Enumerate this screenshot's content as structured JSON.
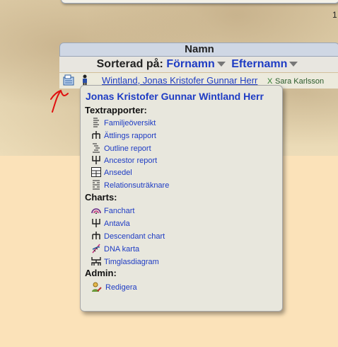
{
  "page": {
    "number": "1"
  },
  "table": {
    "header": "Namn",
    "sort_label": "Sorterad på:",
    "sort_first": "Förnamn",
    "sort_last": "Efternamn"
  },
  "row": {
    "person": "Wintland, Jonas Kristofer Gunnar Herr",
    "x": "X",
    "spouse": "Sara Karlsson"
  },
  "popup": {
    "title": "Jonas Kristofer Gunnar Wintland Herr",
    "sections": {
      "reports": "Textrapporter:",
      "charts": "Charts:",
      "admin": "Admin:"
    },
    "reports": [
      {
        "label": "Familjeöversikt",
        "icon": "family-overview-icon"
      },
      {
        "label": "Ättlings rapport",
        "icon": "descendant-report-icon"
      },
      {
        "label": "Outline report",
        "icon": "outline-report-icon"
      },
      {
        "label": "Ancestor report",
        "icon": "ancestor-report-icon"
      },
      {
        "label": "Ansedel",
        "icon": "ansedel-icon"
      },
      {
        "label": "Relationsuträknare",
        "icon": "relation-calculator-icon"
      }
    ],
    "charts": [
      {
        "label": "Fanchart",
        "icon": "fanchart-icon"
      },
      {
        "label": "Antavla",
        "icon": "antavla-icon"
      },
      {
        "label": "Descendant chart",
        "icon": "descendant-chart-icon"
      },
      {
        "label": "DNA karta",
        "icon": "dna-icon"
      },
      {
        "label": "Timglasdiagram",
        "icon": "hourglass-icon"
      }
    ],
    "admin": [
      {
        "label": "Redigera",
        "icon": "edit-user-icon"
      }
    ]
  },
  "colors": {
    "link": "#1e3cc4",
    "annotation": "#e01010",
    "popup_bg": "#e8e7dd"
  }
}
